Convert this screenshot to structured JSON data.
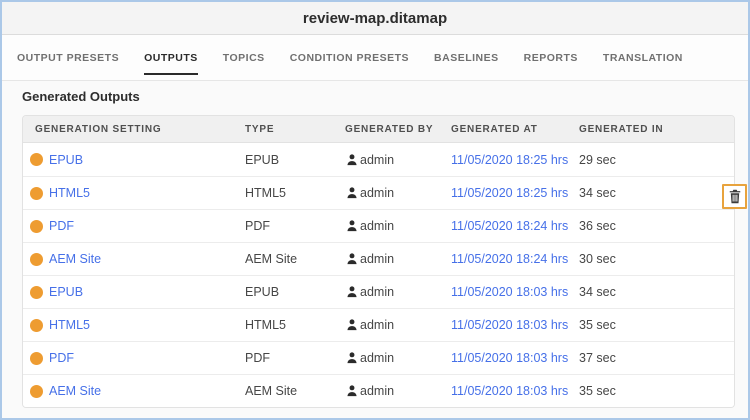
{
  "window": {
    "title": "review-map.ditamap"
  },
  "tabs": [
    {
      "label": "OUTPUT PRESETS",
      "active": false
    },
    {
      "label": "OUTPUTS",
      "active": true
    },
    {
      "label": "TOPICS",
      "active": false
    },
    {
      "label": "CONDITION PRESETS",
      "active": false
    },
    {
      "label": "BASELINES",
      "active": false
    },
    {
      "label": "REPORTS",
      "active": false
    },
    {
      "label": "TRANSLATION",
      "active": false
    }
  ],
  "section": {
    "heading": "Generated Outputs"
  },
  "table": {
    "columns": [
      "GENERATION SETTING",
      "TYPE",
      "GENERATED BY",
      "GENERATED AT",
      "GENERATED IN"
    ],
    "rows": [
      {
        "setting": "EPUB",
        "type": "EPUB",
        "generated_by": "admin",
        "generated_at": "11/05/2020 18:25 hrs",
        "generated_in": "29 sec"
      },
      {
        "setting": "HTML5",
        "type": "HTML5",
        "generated_by": "admin",
        "generated_at": "11/05/2020 18:25 hrs",
        "generated_in": "34 sec"
      },
      {
        "setting": "PDF",
        "type": "PDF",
        "generated_by": "admin",
        "generated_at": "11/05/2020 18:24 hrs",
        "generated_in": "36 sec"
      },
      {
        "setting": "AEM Site",
        "type": "AEM Site",
        "generated_by": "admin",
        "generated_at": "11/05/2020 18:24 hrs",
        "generated_in": "30 sec"
      },
      {
        "setting": "EPUB",
        "type": "EPUB",
        "generated_by": "admin",
        "generated_at": "11/05/2020 18:03 hrs",
        "generated_in": "34 sec"
      },
      {
        "setting": "HTML5",
        "type": "HTML5",
        "generated_by": "admin",
        "generated_at": "11/05/2020 18:03 hrs",
        "generated_in": "35 sec"
      },
      {
        "setting": "PDF",
        "type": "PDF",
        "generated_by": "admin",
        "generated_at": "11/05/2020 18:03 hrs",
        "generated_in": "37 sec"
      },
      {
        "setting": "AEM Site",
        "type": "AEM Site",
        "generated_by": "admin",
        "generated_at": "11/05/2020 18:03 hrs",
        "generated_in": "35 sec"
      }
    ],
    "hovered_row_action": {
      "row_index": 1,
      "icon": "trash-icon"
    }
  },
  "icons": {
    "status": "orange-dot",
    "generated_by": "user-icon",
    "row_action": "trash-icon"
  },
  "colors": {
    "status_dot": "#EE9C31",
    "link": "#4670E8",
    "delete_button_border": "#E8A33D",
    "active_tab_underline": "#2B2B2B",
    "frame_border": "#ABC8E8"
  }
}
